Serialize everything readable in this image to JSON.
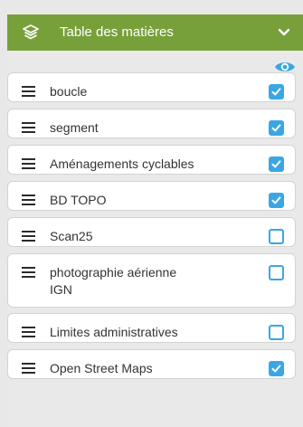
{
  "panel": {
    "title": "Table des matières",
    "colors": {
      "header": "#77a03a",
      "accent": "#3aa7e4"
    },
    "icons": {
      "header": "layers-icon",
      "collapse": "chevron-down-icon",
      "visibility": "eye-icon",
      "drag": "drag-handle-icon"
    }
  },
  "layers": [
    {
      "label": "boucle",
      "visible": true
    },
    {
      "label": "segment",
      "visible": true
    },
    {
      "label": "Aménagements cyclables",
      "visible": true
    },
    {
      "label": "BD TOPO",
      "visible": true
    },
    {
      "label": "Scan25",
      "visible": false
    },
    {
      "label": "photographie aérienne IGN",
      "visible": false
    },
    {
      "label": "Limites administratives",
      "visible": false
    },
    {
      "label": "Open Street Maps",
      "visible": true
    }
  ]
}
